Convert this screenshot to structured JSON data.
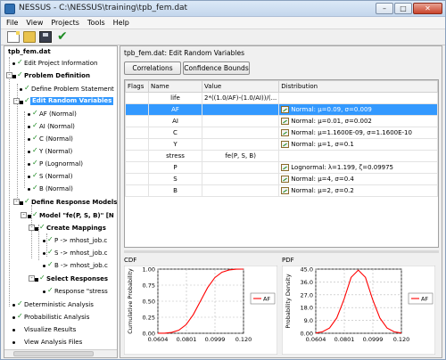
{
  "window": {
    "title": "NESSUS - C:\\NESSUS\\training\\tpb_fem.dat",
    "min": "–",
    "max": "□",
    "close": "✕"
  },
  "menu": [
    "File",
    "View",
    "Projects",
    "Tools",
    "Help"
  ],
  "tree": {
    "root": "tpb_fem.dat",
    "edit_project": "Edit Project Information",
    "problem_definition": "Problem Definition",
    "define_statement": "Define Problem Statement",
    "edit_random": "Edit Random Variables",
    "rv": [
      "AF (Normal)",
      "AI (Normal)",
      "C (Normal)",
      "Y (Normal)",
      "P (Lognormal)",
      "S (Normal)",
      "B (Normal)"
    ],
    "define_response": "Define Response Models",
    "model": "Model \"fe(P, S, B)\" [N",
    "create_mappings": "Create Mappings",
    "mappings": [
      "P -> mhost_job.c",
      "S -> mhost_job.c",
      "B -> mhost_job.c"
    ],
    "select_responses": "Select Responses",
    "response": "Response \"stress",
    "bottom": [
      "Deterministic Analysis",
      "Probabilistic Analysis",
      "Visualize Results",
      "View Analysis Files"
    ]
  },
  "panel": {
    "title": "tpb_fem.dat: Edit Random Variables",
    "correlations": "Correlations",
    "confidence": "Confidence Bounds",
    "headers": [
      "Flags",
      "Name",
      "Value",
      "Distribution"
    ],
    "rows": [
      {
        "name": "life",
        "value": "2*((1.0/AF)-(1.0/AI))/(...",
        "dist": ""
      },
      {
        "name": "AF",
        "value": "",
        "dist": "Normal: μ=0.09, σ=0.009"
      },
      {
        "name": "AI",
        "value": "",
        "dist": "Normal: μ=0.01, σ=0.002"
      },
      {
        "name": "C",
        "value": "",
        "dist": "Normal: μ=1.1600E-09, σ=1.1600E-10"
      },
      {
        "name": "Y",
        "value": "",
        "dist": "Normal: μ=1, σ=0.1"
      },
      {
        "name": "stress",
        "value": "fe(P, S, B)",
        "dist": ""
      },
      {
        "name": "P",
        "value": "",
        "dist": "Lognormal: λ=1.199, ζ=0.09975"
      },
      {
        "name": "S",
        "value": "",
        "dist": "Normal: μ=4, σ=0.4"
      },
      {
        "name": "B",
        "value": "",
        "dist": "Normal: μ=2, σ=0.2"
      }
    ],
    "selected_row": 1
  },
  "colors": {
    "accent": "#3399ff",
    "curve": "#ff0000"
  },
  "chart_data": [
    {
      "type": "line",
      "title": "CDF",
      "ylabel": "Cumulative Probability",
      "xlim": [
        0.0604,
        0.12
      ],
      "ylim": [
        0,
        1
      ],
      "xticks": [
        "0.0604",
        "0.0801",
        "0.0999",
        "0.120"
      ],
      "yticks": [
        "0.00",
        "0.25",
        "0.50",
        "0.75",
        "1.00"
      ],
      "series": [
        {
          "name": "AF",
          "x": [
            0.0604,
            0.065,
            0.07,
            0.075,
            0.08,
            0.085,
            0.09,
            0.095,
            0.1,
            0.105,
            0.11,
            0.115,
            0.12
          ],
          "y": [
            0.0005,
            0.0013,
            0.0132,
            0.0478,
            0.1333,
            0.2893,
            0.5,
            0.7107,
            0.8667,
            0.9522,
            0.9868,
            0.9987,
            0.9999
          ]
        }
      ]
    },
    {
      "type": "line",
      "title": "PDF",
      "ylabel": "Probability Density",
      "xlim": [
        0.0604,
        0.12
      ],
      "ylim": [
        0,
        45
      ],
      "xticks": [
        "0.0604",
        "0.0801",
        "0.0999",
        "0.120"
      ],
      "yticks": [
        "0.00",
        "9.0",
        "18.0",
        "27.0",
        "36.0",
        "45.0"
      ],
      "series": [
        {
          "name": "AF",
          "x": [
            0.0604,
            0.065,
            0.07,
            0.075,
            0.08,
            0.085,
            0.09,
            0.095,
            0.1,
            0.105,
            0.11,
            0.115,
            0.12
          ],
          "y": [
            0.2,
            1.0,
            3.7,
            10.7,
            23.6,
            39.2,
            44.3,
            39.2,
            23.6,
            10.7,
            3.7,
            1.0,
            0.2
          ]
        }
      ]
    }
  ]
}
